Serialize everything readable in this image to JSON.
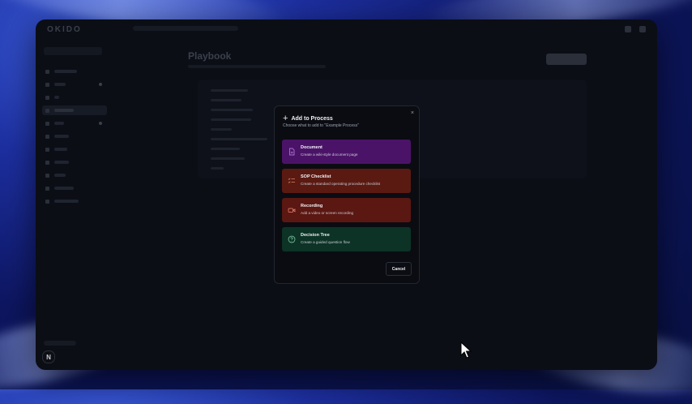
{
  "app": {
    "logo": "OKIDO",
    "page_title": "Playbook",
    "badge_letter": "N"
  },
  "modal": {
    "title": "Add to Process",
    "subtitle": "Choose what to add to \"Example Process\"",
    "close_glyph": "×",
    "options": [
      {
        "title": "Document",
        "description": "Create a wiki-style document page",
        "icon": "document-icon",
        "color": "#4b1368"
      },
      {
        "title": "SOP Checklist",
        "description": "Create a standard operating procedure checklist",
        "icon": "checklist-icon",
        "color": "#5a1a12"
      },
      {
        "title": "Recording",
        "description": "Add a video or screen recording",
        "icon": "video-icon",
        "color": "#5b1712"
      },
      {
        "title": "Decision Tree",
        "description": "Create a guided question flow",
        "icon": "question-circle-icon",
        "color": "#0c3326"
      }
    ],
    "cancel_label": "Cancel"
  },
  "colors": {
    "background": "#0b0e15",
    "document": "#4b1368",
    "sop": "#5a1a12",
    "recording": "#5b1712",
    "decision": "#0c3326"
  }
}
